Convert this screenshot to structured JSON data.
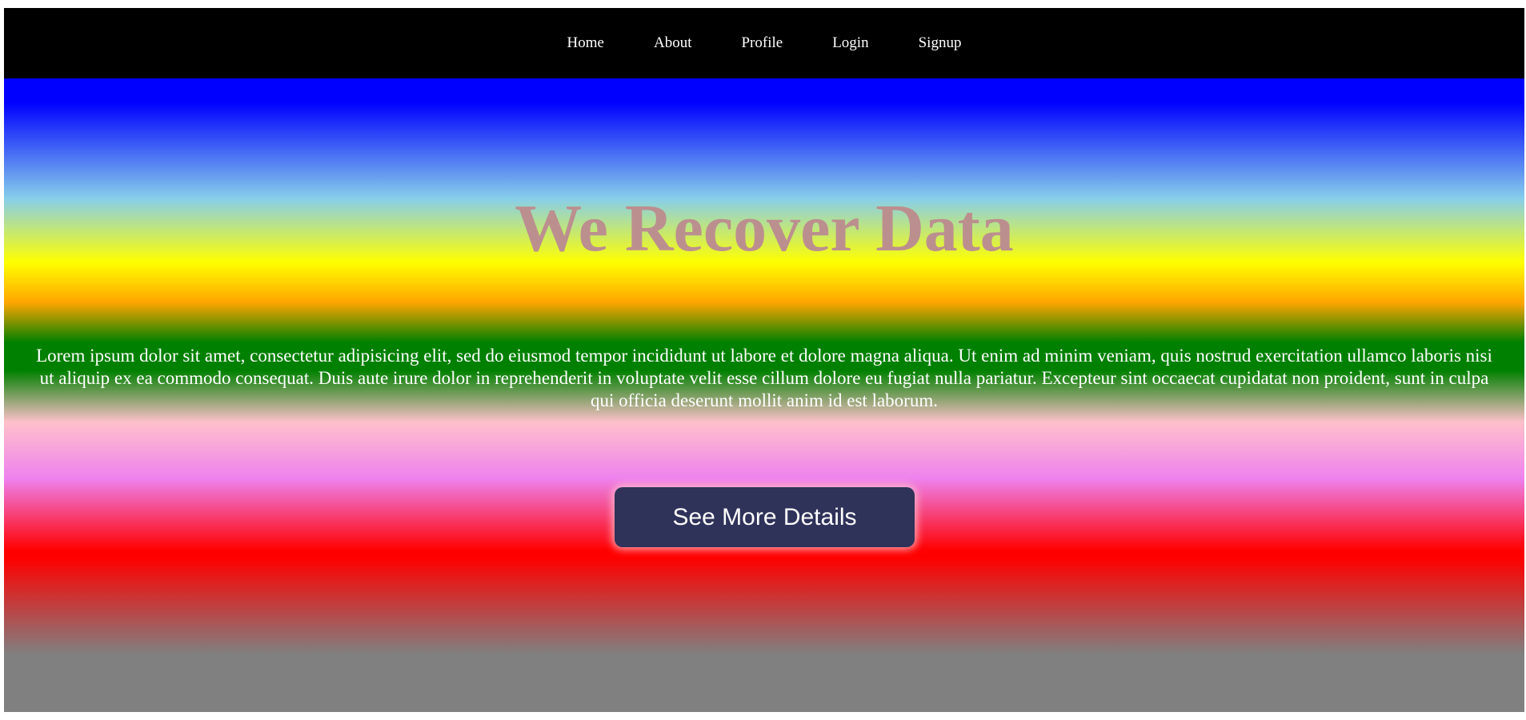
{
  "nav": {
    "items": [
      {
        "label": "Home"
      },
      {
        "label": "About"
      },
      {
        "label": "Profile"
      },
      {
        "label": "Login"
      },
      {
        "label": "Signup"
      }
    ]
  },
  "hero": {
    "title": "We Recover Data",
    "description": "Lorem ipsum dolor sit amet, consectetur adipisicing elit, sed do eiusmod tempor incididunt ut labore et dolore magna aliqua. Ut enim ad minim veniam, quis nostrud exercitation ullamco laboris nisi ut aliquip ex ea commodo consequat. Duis aute irure dolor in reprehenderit in voluptate velit esse cillum dolore eu fugiat nulla pariatur. Excepteur sint occaecat cupidatat non proident, sunt in culpa qui officia deserunt mollit anim id est laborum.",
    "button_label": "See More Details"
  },
  "colors": {
    "navbar_background": "#000000",
    "nav_text": "#ffffff",
    "title_color": "#bc8f8f",
    "button_background": "#2f3259",
    "gradient": [
      "#0000ff",
      "#87ceeb",
      "#ffff00",
      "#ffa500",
      "#008000",
      "#ffc0cb",
      "#ee82ee",
      "#ff0000",
      "#808080"
    ]
  }
}
